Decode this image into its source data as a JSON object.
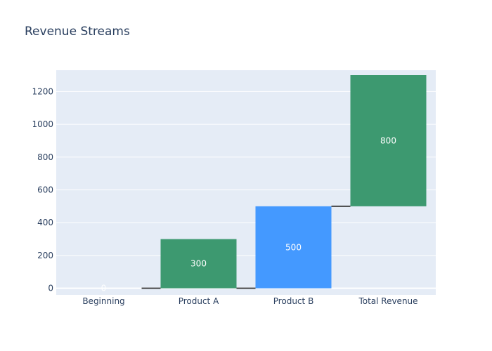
{
  "chart_data": {
    "type": "waterfall",
    "title": "Revenue Streams",
    "xlabel": "",
    "ylabel": "",
    "categories": [
      "Beginning",
      "Product A",
      "Product B",
      "Total Revenue"
    ],
    "bars": [
      {
        "category": "Beginning",
        "base": 0,
        "value": 0,
        "label": "0",
        "color": "#3d9970"
      },
      {
        "category": "Product A",
        "base": 0,
        "value": 300,
        "label": "300",
        "color": "#3d9970"
      },
      {
        "category": "Product B",
        "base": 0,
        "value": 500,
        "label": "500",
        "color": "#4499ff"
      },
      {
        "category": "Total Revenue",
        "base": 500,
        "value": 800,
        "label": "800",
        "color": "#3d9970"
      }
    ],
    "ylim": [
      -40,
      1330
    ],
    "yticks": [
      0,
      200,
      400,
      600,
      800,
      1000,
      1200
    ],
    "grid": true,
    "legend": "none",
    "colors": {
      "plot_background": "#e5ecf6",
      "gridline": "#ffffff",
      "text": "#2a3f5f",
      "connector": "#444444",
      "increasing": "#3d9970",
      "accent_blue": "#4499ff"
    }
  }
}
